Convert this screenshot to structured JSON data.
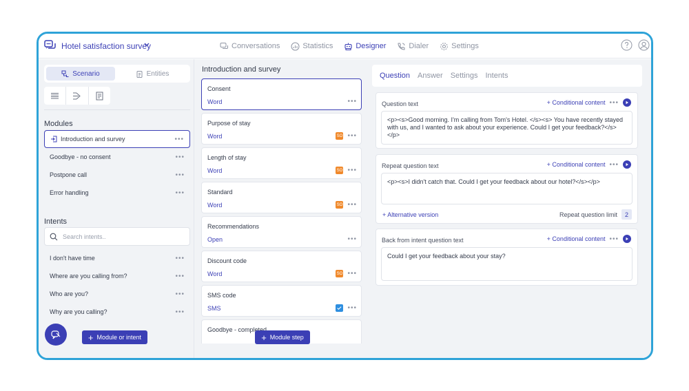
{
  "header": {
    "title": "Hotel satisfaction survey",
    "nav": [
      {
        "label": "Conversations",
        "icon": "chat-icon"
      },
      {
        "label": "Statistics",
        "icon": "chart-icon"
      },
      {
        "label": "Designer",
        "icon": "robot-icon",
        "active": true
      },
      {
        "label": "Dialer",
        "icon": "phone-icon"
      },
      {
        "label": "Settings",
        "icon": "gear-icon"
      }
    ]
  },
  "left": {
    "tabs": {
      "scenario": "Scenario",
      "entities": "Entities"
    },
    "modules_title": "Modules",
    "modules": [
      {
        "label": "Introduction and survey",
        "active": true
      },
      {
        "label": "Goodbye - no consent"
      },
      {
        "label": "Postpone call"
      },
      {
        "label": "Error handling"
      }
    ],
    "intents_title": "Intents",
    "search_placeholder": "Search intents..",
    "intents": [
      {
        "label": "I don't have time"
      },
      {
        "label": "Where are you calling from?"
      },
      {
        "label": "Who are you?"
      },
      {
        "label": "Why are you calling?"
      }
    ],
    "add_button": "Module or intent"
  },
  "middle": {
    "title": "Introduction and survey",
    "steps": [
      {
        "name": "Consent",
        "type": "Word",
        "badge": ""
      },
      {
        "name": "Purpose of stay",
        "type": "Word",
        "badge": "SO"
      },
      {
        "name": "Length of stay",
        "type": "Word",
        "badge": "SO"
      },
      {
        "name": "Standard",
        "type": "Word",
        "badge": "SO"
      },
      {
        "name": "Recommendations",
        "type": "Open",
        "badge": ""
      },
      {
        "name": "Discount code",
        "type": "Word",
        "badge": "SO"
      },
      {
        "name": "SMS code",
        "type": "SMS",
        "badge": "check"
      },
      {
        "name": "Goodbye - completed",
        "type": "",
        "badge": ""
      }
    ],
    "add_button": "Module step"
  },
  "right": {
    "tabs": [
      "Question",
      "Answer",
      "Settings",
      "Intents"
    ],
    "conditional": "+ Conditional content",
    "cards": {
      "question": {
        "label": "Question text",
        "text": "<p><s>Good morning. I'm calling from Tom's Hotel. </s><s> You have recently stayed with us, and I wanted to ask about your experience. Could I get your feedback?</s></p>"
      },
      "repeat": {
        "label": "Repeat question text",
        "text": "<p><s>I didn't catch that. Could I get your feedback about our hotel?</s></p>",
        "alt": "+ Alternative version",
        "limit_label": "Repeat question limit",
        "limit_value": "2"
      },
      "back": {
        "label": "Back from intent question text",
        "text": "Could I get your feedback about your stay?"
      }
    }
  },
  "colors": {
    "accent": "#3b3fb5",
    "frame": "#2ea3d8",
    "badge_orange": "#f0892b",
    "badge_blue": "#2e8fe0"
  }
}
